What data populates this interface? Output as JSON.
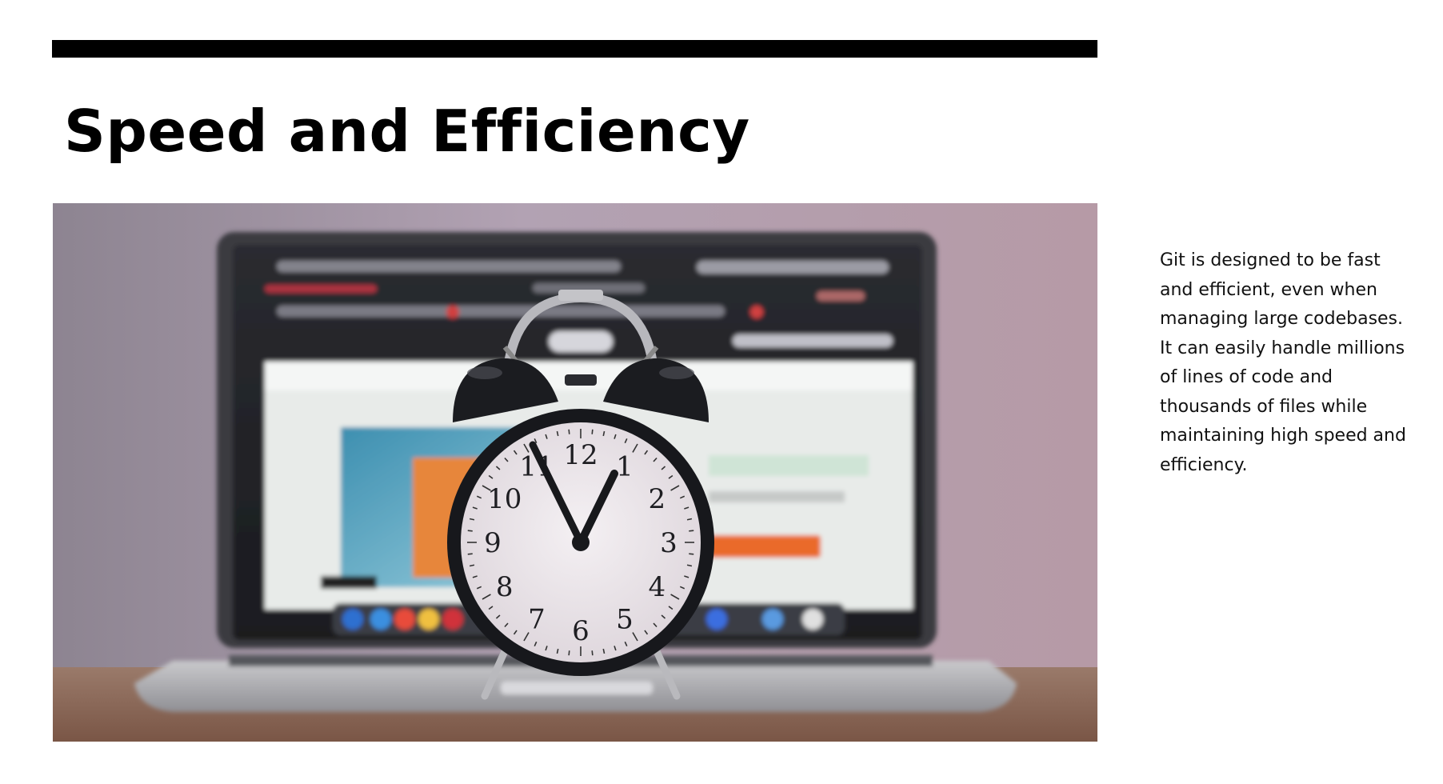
{
  "slide": {
    "title": "Speed and Efficiency",
    "body": "Git is designed to be fast and efficient, even when managing large codebases. It can easily handle millions of lines of code and thousands of files while maintaining high speed and efficiency.",
    "image": {
      "subject": "alarm clock in front of laptop",
      "clock_numerals": [
        "12",
        "1",
        "2",
        "3",
        "4",
        "5",
        "6",
        "7",
        "8",
        "9",
        "10",
        "11"
      ]
    }
  },
  "colors": {
    "bar": "#000000",
    "title": "#000000",
    "body": "#111111",
    "background": "#ffffff"
  }
}
